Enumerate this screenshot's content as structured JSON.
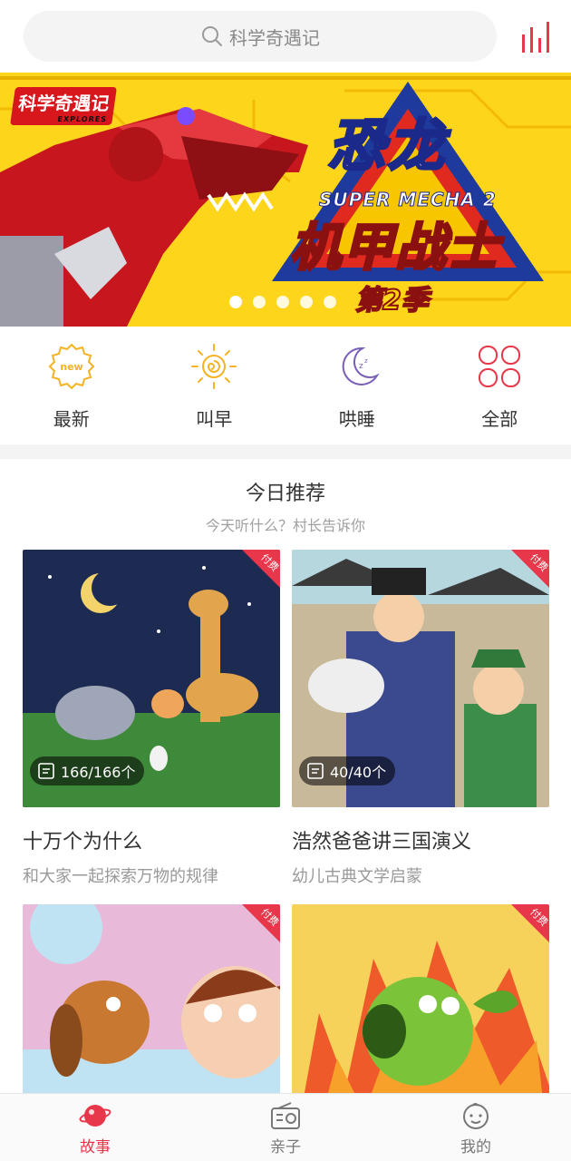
{
  "search": {
    "placeholder": "科学奇遇记",
    "icon": "search-icon"
  },
  "banner": {
    "logo": "科学奇遇记",
    "logo_sub": "EXPLORES",
    "title_top": "恐龙",
    "subtitle": "SUPER MECHA 2",
    "title_bottom": "机甲战士",
    "season": "第2季",
    "slide_count": 5,
    "active_slide": 1
  },
  "categories": [
    {
      "label": "最新",
      "icon": "new-badge-icon",
      "color": "#f5b323"
    },
    {
      "label": "叫早",
      "icon": "sun-icon",
      "color": "#f5b323"
    },
    {
      "label": "哄睡",
      "icon": "moon-icon",
      "color": "#7a5fb8"
    },
    {
      "label": "全部",
      "icon": "grid-icon",
      "color": "#e8374a"
    }
  ],
  "section": {
    "title": "今日推荐",
    "subtitle": "今天听什么？村长告诉你"
  },
  "cards": [
    {
      "title": "十万个为什么",
      "desc": "和大家一起探索万物的规律",
      "count": "166/166个",
      "badge": "付费"
    },
    {
      "title": "浩然爸爸讲三国演义",
      "desc": "幼儿古典文学启蒙",
      "count": "40/40个",
      "badge": "付费"
    },
    {
      "badge": "付费"
    },
    {
      "badge": "付费"
    }
  ],
  "nav": [
    {
      "label": "故事",
      "icon": "planet-icon",
      "active": true
    },
    {
      "label": "亲子",
      "icon": "radio-icon",
      "active": false
    },
    {
      "label": "我的",
      "icon": "baby-face-icon",
      "active": false
    }
  ],
  "colors": {
    "accent": "#e8374a",
    "banner_bg": "#fdd51b"
  }
}
